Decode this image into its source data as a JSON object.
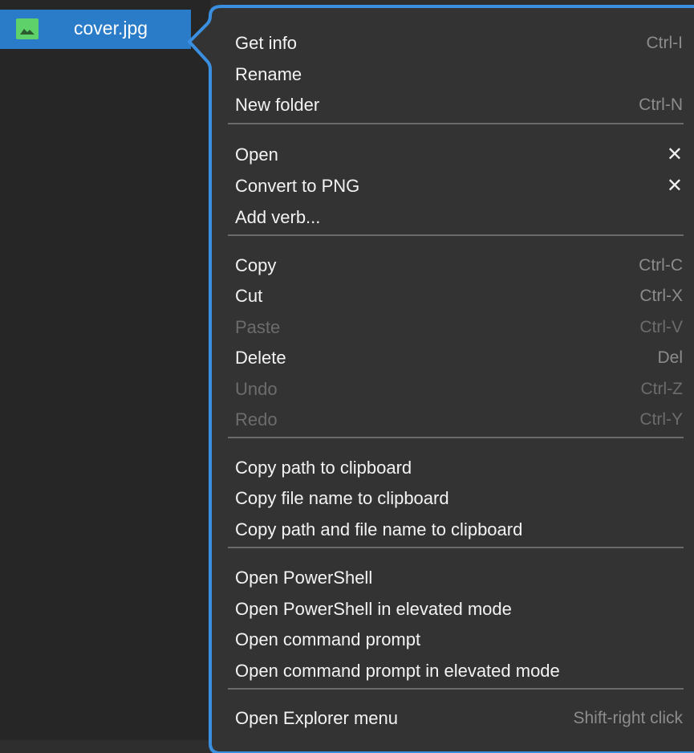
{
  "file": {
    "name": "cover.jpg",
    "icon": "image-file-icon"
  },
  "menu": {
    "items": [
      {
        "label": "Get info",
        "shortcut": "Ctrl-I",
        "disabled": false
      },
      {
        "label": "Rename",
        "shortcut": "",
        "disabled": false
      },
      {
        "label": "New folder",
        "shortcut": "Ctrl-N",
        "disabled": false
      },
      {
        "label": "Open",
        "close": "✕",
        "disabled": false
      },
      {
        "label": "Convert to PNG",
        "close": "✕",
        "disabled": false
      },
      {
        "label": "Add verb...",
        "shortcut": "",
        "disabled": false
      },
      {
        "label": "Copy",
        "shortcut": "Ctrl-C",
        "disabled": false
      },
      {
        "label": "Cut",
        "shortcut": "Ctrl-X",
        "disabled": false
      },
      {
        "label": "Paste",
        "shortcut": "Ctrl-V",
        "disabled": true
      },
      {
        "label": "Delete",
        "shortcut": "Del",
        "disabled": false
      },
      {
        "label": "Undo",
        "shortcut": "Ctrl-Z",
        "disabled": true
      },
      {
        "label": "Redo",
        "shortcut": "Ctrl-Y",
        "disabled": true
      },
      {
        "label": "Copy path to clipboard",
        "shortcut": "",
        "disabled": false
      },
      {
        "label": "Copy file name to clipboard",
        "shortcut": "",
        "disabled": false
      },
      {
        "label": "Copy path and file name to clipboard",
        "shortcut": "",
        "disabled": false
      },
      {
        "label": "Open PowerShell",
        "shortcut": "",
        "disabled": false
      },
      {
        "label": "Open PowerShell in elevated mode",
        "shortcut": "",
        "disabled": false
      },
      {
        "label": "Open command prompt",
        "shortcut": "",
        "disabled": false
      },
      {
        "label": "Open command prompt in elevated mode",
        "shortcut": "",
        "disabled": false
      },
      {
        "label": "Open Explorer menu",
        "shortcut": "Shift-right click",
        "disabled": false
      }
    ]
  },
  "colors": {
    "accent": "#2a7cc9",
    "menu_border": "#3a8fe0",
    "icon_green": "#5fd16a"
  }
}
